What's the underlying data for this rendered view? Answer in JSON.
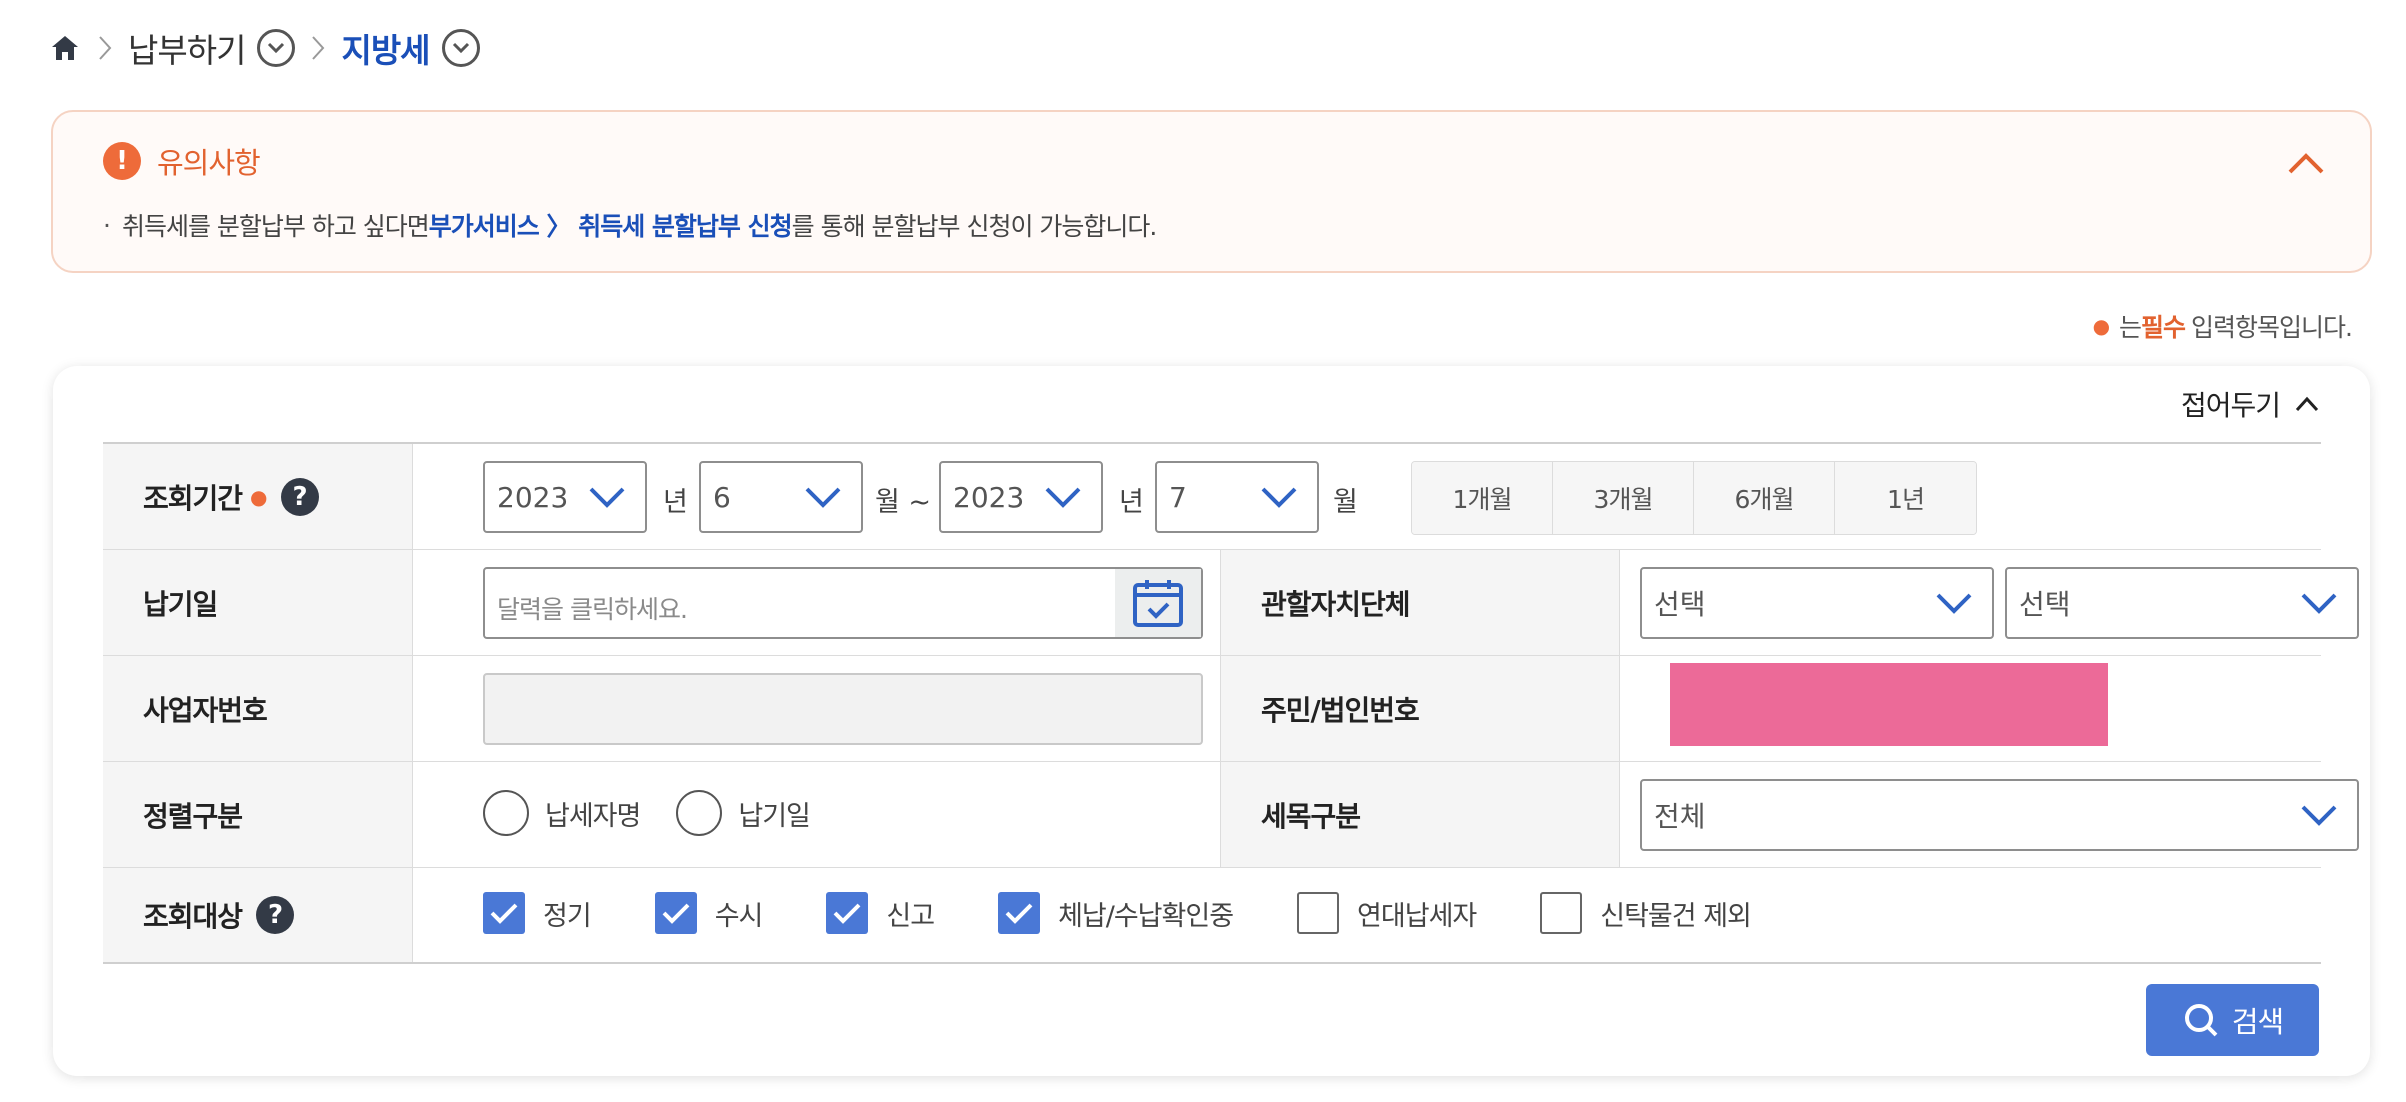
{
  "breadcrumb": {
    "home_icon": "home-icon",
    "items": [
      "납부하기",
      "지방세"
    ]
  },
  "notice": {
    "title": "유의사항",
    "text_before": "취득세를 분할납부 하고 싶다면 ",
    "link_text": "부가서비스 〉 취득세 분할납부 신청",
    "text_after": "를 통해 분할납부 신청이 가능합니다."
  },
  "required_note": {
    "prefix": "는 ",
    "required_word": "필수",
    "suffix": "입력항목입니다."
  },
  "form": {
    "fold_label": "접어두기",
    "period": {
      "label": "조회기간",
      "from_year": "2023",
      "from_month": "6",
      "to_year": "2023",
      "to_month": "7",
      "unit_year": "년",
      "unit_month_tilde": "월 ~",
      "unit_month": "월",
      "quick_buttons": [
        "1개월",
        "3개월",
        "6개월",
        "1년"
      ]
    },
    "due_date": {
      "label": "납기일",
      "placeholder": "달력을 클릭하세요."
    },
    "jurisdiction": {
      "label": "관할자치단체",
      "select1": "선택",
      "select2": "선택"
    },
    "business_no": {
      "label": "사업자번호",
      "value": ""
    },
    "resident_no": {
      "label": "주민/법인번호"
    },
    "sort": {
      "label": "정렬구분",
      "options": [
        "납세자명",
        "납기일"
      ]
    },
    "tax_item": {
      "label": "세목구분",
      "value": "전체"
    },
    "target": {
      "label": "조회대상",
      "options": [
        {
          "label": "정기",
          "checked": true
        },
        {
          "label": "수시",
          "checked": true
        },
        {
          "label": "신고",
          "checked": true
        },
        {
          "label": "체납/수납확인중",
          "checked": true
        },
        {
          "label": "연대납세자",
          "checked": false
        },
        {
          "label": "신탁물건 제외",
          "checked": false
        }
      ]
    },
    "search_label": "검색"
  },
  "colors": {
    "accent": "#1a4fb8",
    "warning": "#ee6b3a",
    "button": "#4a78d6",
    "masked": "#ec6a98"
  }
}
